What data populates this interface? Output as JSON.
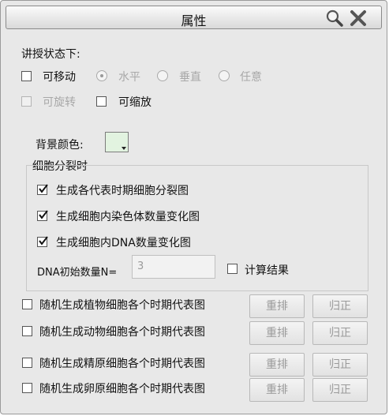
{
  "window": {
    "title": "属性",
    "search_icon": "magnifier-icon",
    "close_icon": "close-x-icon"
  },
  "teaching_mode": {
    "label": "讲授状态下:",
    "movable": {
      "label": "可移动",
      "checked": false,
      "enabled": true
    },
    "radios": [
      {
        "label": "水平",
        "selected": true,
        "enabled": false
      },
      {
        "label": "垂直",
        "selected": false,
        "enabled": false
      },
      {
        "label": "任意",
        "selected": false,
        "enabled": false
      }
    ],
    "rotatable": {
      "label": "可旋转",
      "checked": false,
      "enabled": false
    },
    "scalable": {
      "label": "可缩放",
      "checked": false,
      "enabled": true
    }
  },
  "background": {
    "label": "背景颜色:",
    "color": "#e2f3e0"
  },
  "division": {
    "group_label": "细胞分裂时",
    "options": [
      {
        "label": "生成各代表时期细胞分裂图",
        "checked": true
      },
      {
        "label": "生成细胞内染色体数量变化图",
        "checked": true
      },
      {
        "label": "生成细胞内DNA数量变化图",
        "checked": true
      }
    ],
    "dna_label": "DNA初始数量N=",
    "dna_value": "3",
    "calc_label": "计算结果",
    "calc_checked": false
  },
  "random_rows": [
    {
      "label": "随机生成植物细胞各个时期代表图",
      "checked": false,
      "rearrange": "重排",
      "reset": "归正"
    },
    {
      "label": "随机生成动物细胞各个时期代表图",
      "checked": false,
      "rearrange": "重排",
      "reset": "归正"
    },
    {
      "label": "随机生成精原细胞各个时期代表图",
      "checked": false,
      "rearrange": "重排",
      "reset": "归正"
    },
    {
      "label": "随机生成卵原细胞各个时期代表图",
      "checked": false,
      "rearrange": "重排",
      "reset": "归正"
    }
  ]
}
